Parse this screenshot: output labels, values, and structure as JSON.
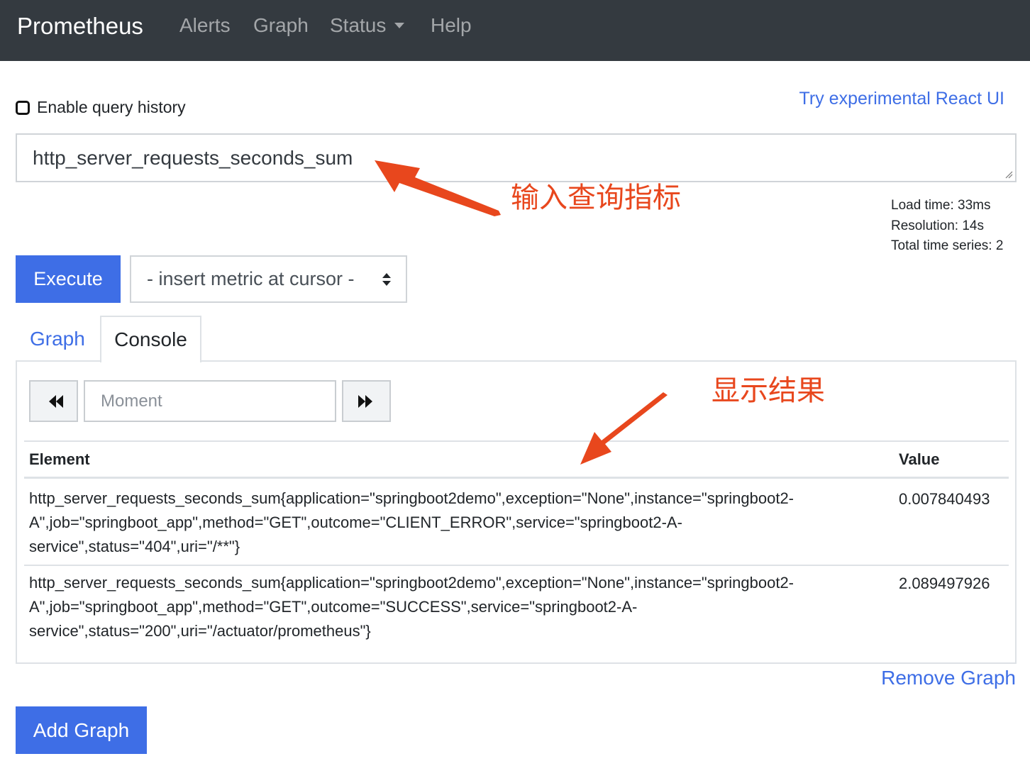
{
  "navbar": {
    "brand": "Prometheus",
    "items": [
      {
        "label": "Alerts"
      },
      {
        "label": "Graph"
      },
      {
        "label": "Status"
      },
      {
        "label": "Help"
      }
    ]
  },
  "options": {
    "history_label": "Enable query history",
    "history_checked": false,
    "react_link": "Try experimental React UI"
  },
  "query": {
    "expression": "http_server_requests_seconds_sum"
  },
  "stats": {
    "load_time": "Load time: 33ms",
    "resolution": "Resolution: 14s",
    "total_series": "Total time series: 2"
  },
  "controls": {
    "execute_label": "Execute",
    "metric_select": "- insert metric at cursor -"
  },
  "tabs": [
    {
      "label": "Graph",
      "active": false
    },
    {
      "label": "Console",
      "active": true
    }
  ],
  "console": {
    "moment_placeholder": "Moment",
    "table": {
      "headers": [
        "Element",
        "Value"
      ],
      "rows": [
        {
          "element": "http_server_requests_seconds_sum{application=\"springboot2demo\",exception=\"None\",instance=\"springboot2-A\",job=\"springboot_app\",method=\"GET\",outcome=\"CLIENT_ERROR\",service=\"springboot2-A-service\",status=\"404\",uri=\"/**\"}",
          "value": "0.007840493"
        },
        {
          "element": "http_server_requests_seconds_sum{application=\"springboot2demo\",exception=\"None\",instance=\"springboot2-A\",job=\"springboot_app\",method=\"GET\",outcome=\"SUCCESS\",service=\"springboot2-A-service\",status=\"200\",uri=\"/actuator/prometheus\"}",
          "value": "2.089497926"
        }
      ]
    }
  },
  "actions": {
    "remove_graph": "Remove Graph",
    "add_graph": "Add Graph"
  },
  "annotations": {
    "query_hint": "输入查询指标",
    "result_hint": "显示结果"
  },
  "colors": {
    "navbar": "#343a40",
    "primary": "#3e6ee6",
    "annotation": "#e8471d"
  }
}
